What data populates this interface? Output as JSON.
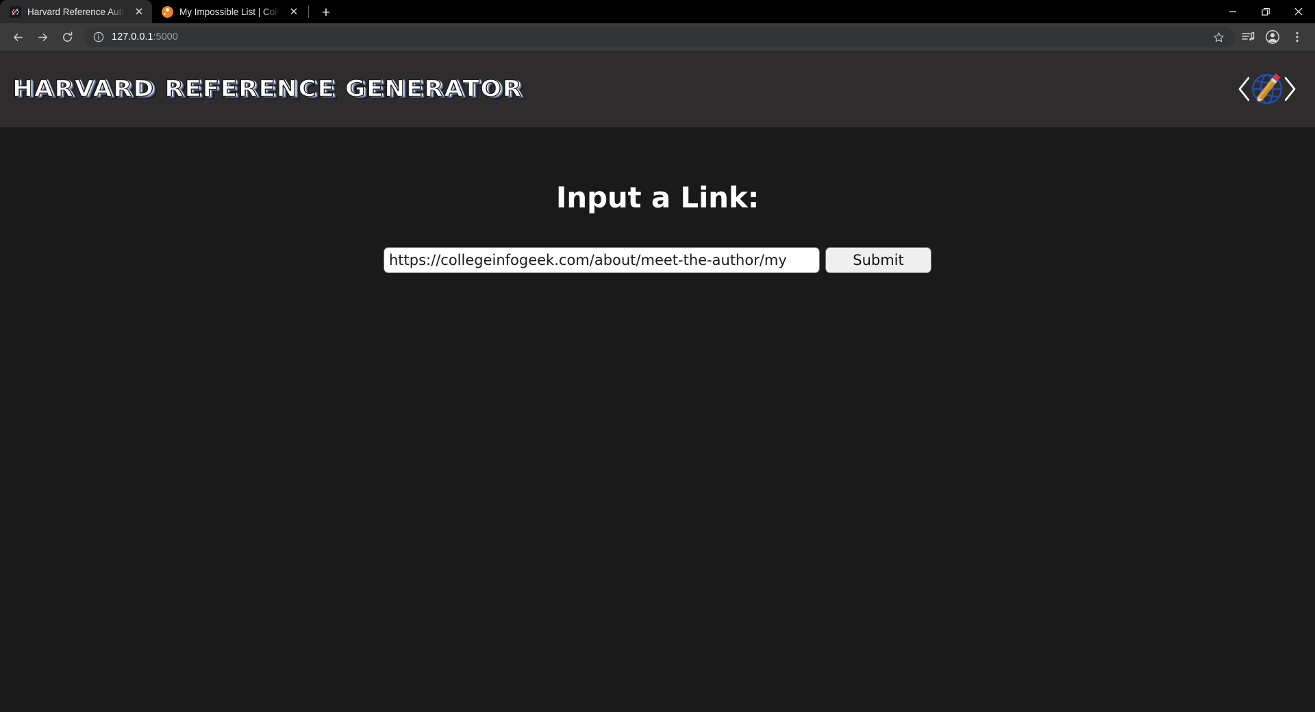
{
  "browser": {
    "tabs": [
      {
        "title": "Harvard Reference Auto Builder -",
        "favicon": "pencil-code-icon",
        "active": true,
        "close_label": "✕"
      },
      {
        "title": "My Impossible List | College Info",
        "favicon": "orange-circle-icon",
        "active": false,
        "close_label": "✕"
      }
    ],
    "new_tab_label": "+",
    "window_controls": {
      "minimize": "—",
      "maximize": "❐",
      "close": "✕"
    },
    "nav": {
      "back": "back-arrow",
      "forward": "forward-arrow",
      "reload": "reload-arrow"
    },
    "address": {
      "host": "127.0.0.1",
      "port": ":5000",
      "site_info_icon": "info-circle-icon"
    },
    "actions": {
      "bookmark": "star-icon",
      "reading_list": "reading-list-icon",
      "profile": "profile-avatar-icon",
      "menu": "three-dot-menu-icon"
    }
  },
  "page": {
    "brand_title": "HARVARD REFERENCE GENERATOR",
    "logo_name": "globe-pencil-code-logo",
    "heading": "Input a Link:",
    "input": {
      "value": "https://collegeinfogeek.com/about/meet-the-author/my",
      "placeholder": ""
    },
    "submit_label": "Submit"
  },
  "colors": {
    "tabstrip_bg": "#000000",
    "toolbar_bg": "#3b3b3b",
    "active_tab_bg": "#2b2b2b",
    "site_header_bg": "#2e2c2c",
    "page_bg": "#1b1a1a",
    "text_white": "#ffffff",
    "logo_blue": "#1f4fb0",
    "pencil_body": "#e0a53c",
    "button_bg": "#efefef"
  }
}
